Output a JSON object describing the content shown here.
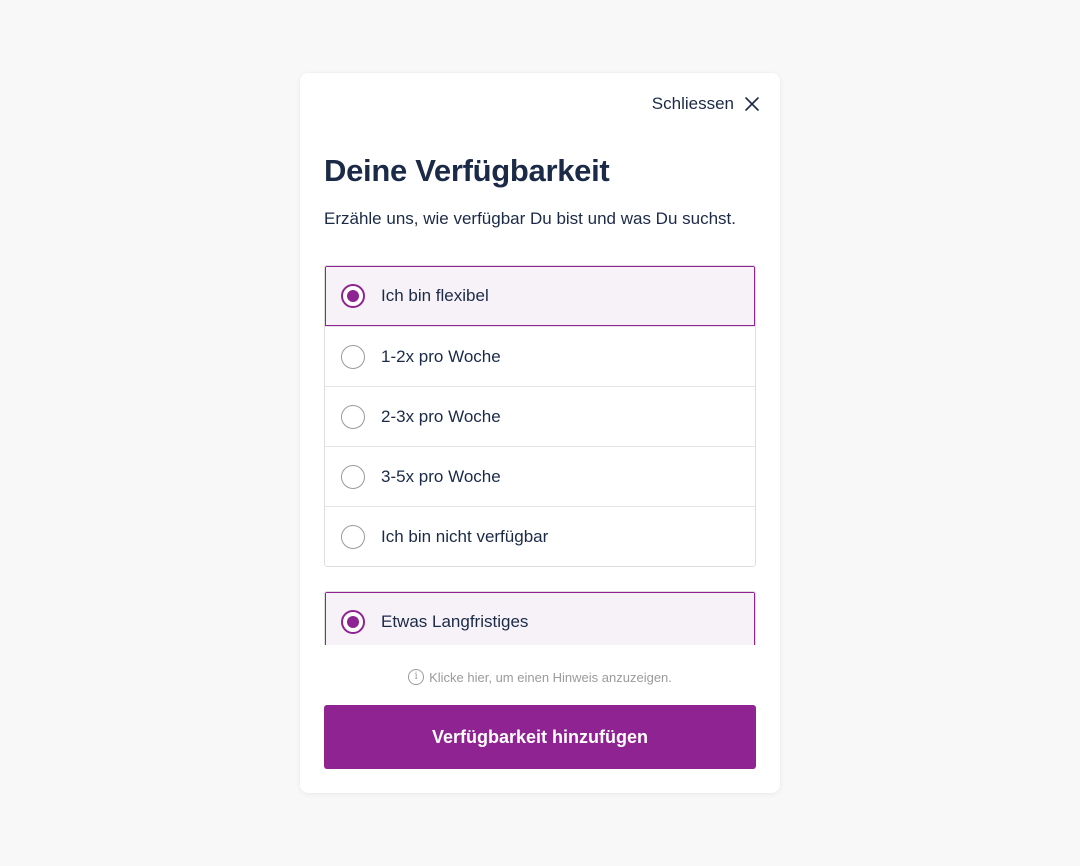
{
  "modal": {
    "close_label": "Schliessen",
    "title": "Deine Verfügbarkeit",
    "subtitle": "Erzähle uns, wie verfügbar Du bist und was Du suchst.",
    "frequency_options": [
      {
        "label": "Ich bin flexibel",
        "selected": true
      },
      {
        "label": "1-2x pro Woche",
        "selected": false
      },
      {
        "label": "2-3x pro Woche",
        "selected": false
      },
      {
        "label": "3-5x pro Woche",
        "selected": false
      },
      {
        "label": "Ich bin nicht verfügbar",
        "selected": false
      }
    ],
    "duration_options": [
      {
        "label": "Etwas Langfristiges",
        "selected": true
      }
    ],
    "hint_text": "Klicke hier, um einen Hinweis anzuzeigen.",
    "hint_icon": "info-icon",
    "submit_label": "Verfügbarkeit hinzufügen"
  },
  "colors": {
    "accent": "#8e2391",
    "selected_bg": "#f7f2f8",
    "text": "#1b2a47",
    "page_bg": "#f8f8f8"
  }
}
